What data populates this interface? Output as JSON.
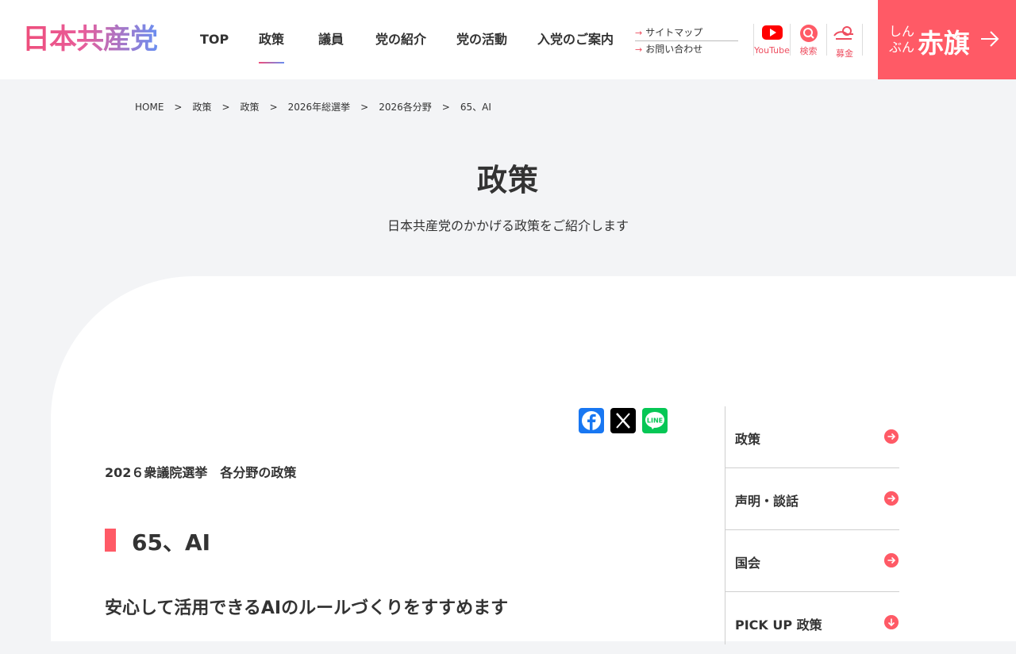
{
  "header": {
    "logo_text": "日本共産党",
    "nav": [
      {
        "label": "TOP"
      },
      {
        "label": "政策"
      },
      {
        "label": "議員"
      },
      {
        "label": "党の紹介"
      },
      {
        "label": "党の活動"
      },
      {
        "label": "入党のご案内"
      }
    ],
    "active_nav": "政策",
    "sub_links": [
      {
        "label": "サイトマップ"
      },
      {
        "label": "お問い合わせ"
      }
    ],
    "icons": [
      {
        "name": "youtube-icon",
        "label": "YouTube"
      },
      {
        "name": "search-icon",
        "label": "検索"
      },
      {
        "name": "donation-icon",
        "label": "募金"
      }
    ],
    "akahata": {
      "small_text": "しんぶん",
      "big_text": "赤旗"
    }
  },
  "breadcrumb": [
    "HOME",
    "政策",
    "政策",
    "2026年総選挙",
    "2026各分野",
    "65、AI"
  ],
  "breadcrumb_separator": ">",
  "hero": {
    "title": "政策",
    "subtitle": "日本共産党のかかげる政策をご紹介します"
  },
  "share": [
    {
      "name": "facebook-share-button",
      "color": "#1877f2"
    },
    {
      "name": "x-share-button",
      "color": "#000000"
    },
    {
      "name": "line-share-button",
      "color": "#06c755"
    }
  ],
  "article": {
    "intro": "202６衆議院選挙　各分野の政策",
    "heading": "65、AI",
    "subheading": "安心して活用できるAIのルールづくりをすすめます"
  },
  "sidebar": [
    {
      "label": "政策"
    },
    {
      "label": "声明・談話"
    },
    {
      "label": "国会"
    },
    {
      "label": "PICK UP 政策"
    }
  ],
  "colors": {
    "accent": "#ff5a66",
    "background": "#f3f4f6"
  }
}
